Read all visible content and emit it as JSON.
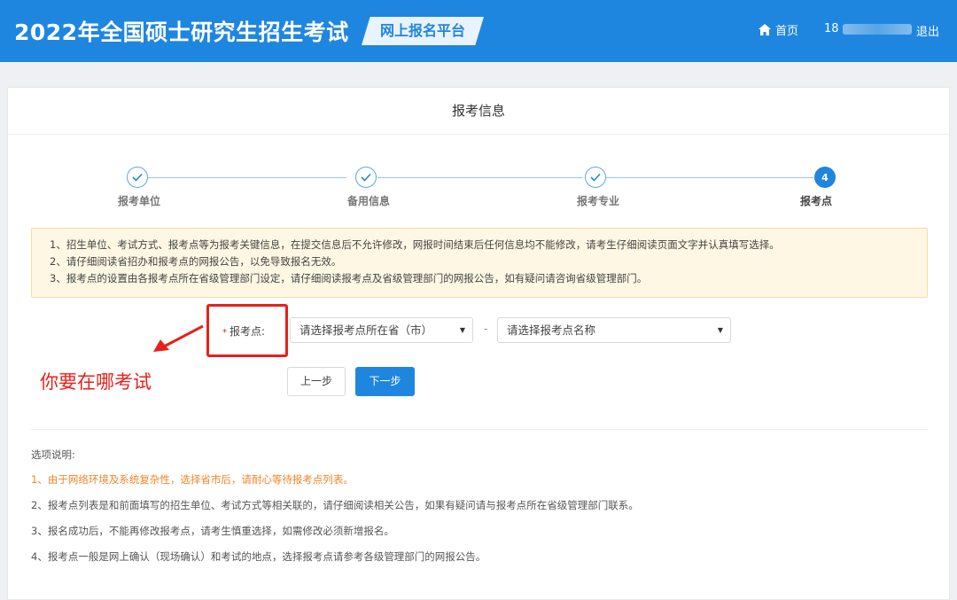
{
  "header": {
    "title": "2022年全国硕士研究生招生考试",
    "platform": "网上报名平台",
    "home": "首页",
    "user_prefix": "18",
    "logout": "退出"
  },
  "card": {
    "title": "报考信息"
  },
  "steps": [
    {
      "label": "报考单位",
      "state": "done"
    },
    {
      "label": "备用信息",
      "state": "done"
    },
    {
      "label": "报考专业",
      "state": "done"
    },
    {
      "label": "报考点",
      "state": "active",
      "number": "4"
    }
  ],
  "notice": [
    "1、招生单位、考试方式、报考点等为报考关键信息，在提交信息后不允许修改，网报时间结束后任何信息均不能修改，请考生仔细阅读页面文字并认真填写选择。",
    "2、请仔细阅读省招办和报考点的网报公告，以免导致报名无效。",
    "3、报考点的设置由各报考点所在省级管理部门设定，请仔细阅读报考点及省级管理部门的网报公告，如有疑问请咨询省级管理部门。"
  ],
  "form": {
    "required_mark": "*",
    "label": "报考点:",
    "province_select": "请选择报考点所在省（市）",
    "separator": "-",
    "site_select": "请选择报考点名称"
  },
  "annotation": {
    "text": "你要在哪考试"
  },
  "buttons": {
    "prev": "上一步",
    "next": "下一步"
  },
  "options": {
    "title": "选项说明:",
    "items": [
      "1、由于网络环境及系统复杂性，选择省市后，请耐心等待报考点列表。",
      "2、报考点列表是和前面填写的招生单位、考试方式等相关联的，请仔细阅读相关公告，如果有疑问请与报考点所在省级管理部门联系。",
      "3、报名成功后，不能再修改报考点，请考生慎重选择，如需修改必须新增报名。",
      "4、报考点一般是网上确认（现场确认）和考试的地点，选择报考点请参考各级管理部门的网报公告。"
    ]
  },
  "colors": {
    "primary": "#1f86e0",
    "warning_text": "#f0862a",
    "annotation": "#e8201a",
    "notice_bg": "#fdf7e3"
  }
}
